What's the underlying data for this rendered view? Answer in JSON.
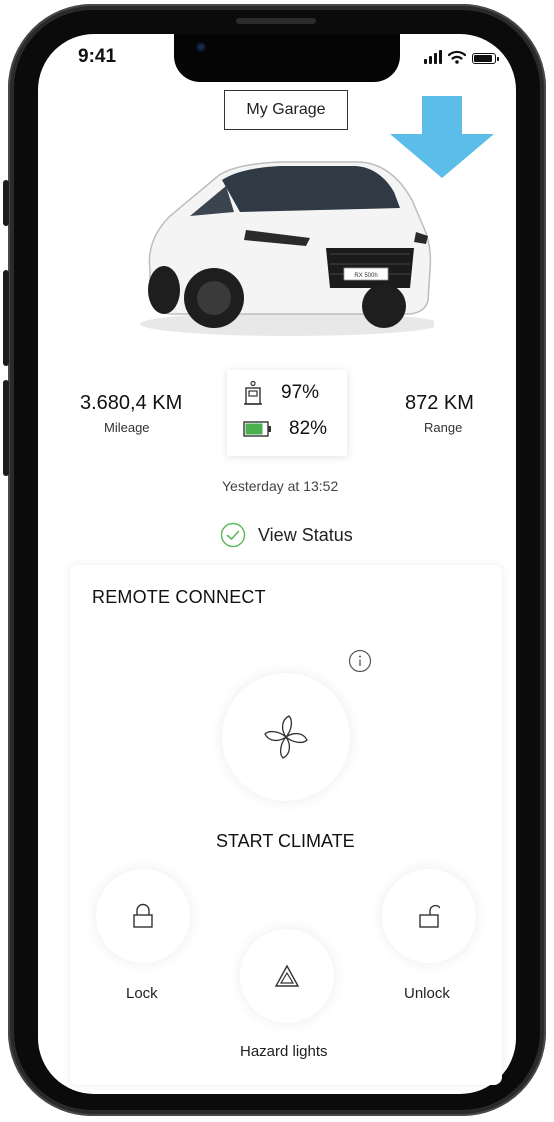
{
  "status_bar": {
    "time": "9:41"
  },
  "header": {
    "garage_label": "My Garage"
  },
  "vehicle": {
    "plate": "RX 500h"
  },
  "stats": {
    "mileage_value": "3.680,4 KM",
    "mileage_label": "Mileage",
    "range_value": "872 KM",
    "range_label": "Range",
    "fuel_percent": "97%",
    "battery_percent": "82%",
    "updated": "Yesterday at 13:52"
  },
  "status_link": {
    "label": "View Status"
  },
  "remote": {
    "title": "REMOTE CONNECT",
    "climate_label": "START CLIMATE",
    "lock_label": "Lock",
    "unlock_label": "Unlock",
    "hazard_label": "Hazard lights"
  },
  "colors": {
    "arrow": "#5bbde8",
    "battery": "#4caf50",
    "check": "#5cb85c"
  },
  "icons": [
    "fuel-pump-icon",
    "battery-icon",
    "check-circle-icon",
    "info-icon",
    "fan-icon",
    "lock-icon",
    "unlock-icon",
    "hazard-icon",
    "down-arrow-icon"
  ]
}
